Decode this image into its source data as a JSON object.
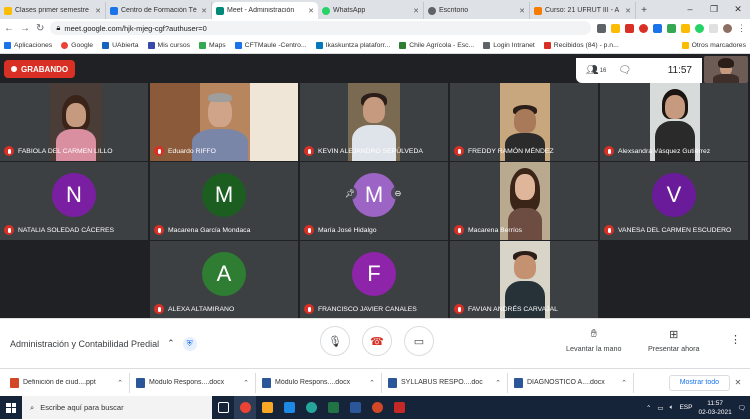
{
  "browser": {
    "tabs": [
      {
        "title": "Clases primer semestre",
        "color": "#fbbc04",
        "active": false
      },
      {
        "title": "Centro de Formación Té",
        "color": "#1a73e8",
        "active": false
      },
      {
        "title": "Meet - Administración",
        "color": "#00897b",
        "active": true
      },
      {
        "title": "WhatsApp",
        "color": "#25d366",
        "active": false
      },
      {
        "title": "Escritorio",
        "color": "#5f6368",
        "active": false
      },
      {
        "title": "Curso: 21 UFRUT III - A",
        "color": "#f57c00",
        "active": false
      }
    ],
    "url": "meet.google.com/hjk-mjeg-cgf?authuser=0",
    "bookmarks": [
      "Aplicaciones",
      "Google",
      "UAbierta",
      "Mis cursos",
      "Maps",
      "CFTMaule -Centro...",
      "Ikaskuntza plataforr...",
      "Chile Agrícola - Esc...",
      "Login Intranet",
      "Recibidos (84) - p.n..."
    ],
    "other_bookmarks": "Otros marcadores"
  },
  "meet": {
    "recording_label": "GRABANDO",
    "participants_count": "16",
    "time": "11:57",
    "meeting_name": "Administración y Contabilidad Predial",
    "raise_hand_label": "Levantar la mano",
    "present_label": "Presentar ahora",
    "participants": [
      "FABIOLA DEL CARMEN LILLO",
      "Eduardo RIFFO",
      "KEVIN ALEJANDRO SEPÚLVEDA",
      "FREDDY RAMÓN MÉNDEZ",
      "Alexsandra Vásquez Gutiérrez",
      "NATALIA SOLEDAD CÁCERES",
      "Macarena García Mondaca",
      "María José Hidalgo",
      "Macarena Berríos",
      "VANESA DEL CARMEN ESCUDERO",
      "ALEXA ALTAMIRANO",
      "FRANCISCO JAVIER CANALES",
      "FAVIAN ANDRÉS CARVAJAL"
    ],
    "avatars": [
      {
        "letter": "N",
        "color": "#7b1fa2"
      },
      {
        "letter": "M",
        "color": "#1b5e20"
      },
      {
        "letter": "M",
        "color": "#9c64c4"
      },
      {
        "letter": "V",
        "color": "#6a1b9a"
      },
      {
        "letter": "A",
        "color": "#2e7d32"
      },
      {
        "letter": "F",
        "color": "#8e24aa"
      }
    ]
  },
  "downloads": {
    "items": [
      "Definición de ciud....ppt",
      "Módulo Respons....docx",
      "Módulo Respons....docx",
      "SYLLABUS RESPO....doc",
      "DIAGNÓSTICO A....docx"
    ],
    "show_all": "Mostrar todo"
  },
  "taskbar": {
    "search_placeholder": "Escribe aquí para buscar",
    "lang": "ESP",
    "time": "11:57",
    "date": "02-03-2021"
  }
}
